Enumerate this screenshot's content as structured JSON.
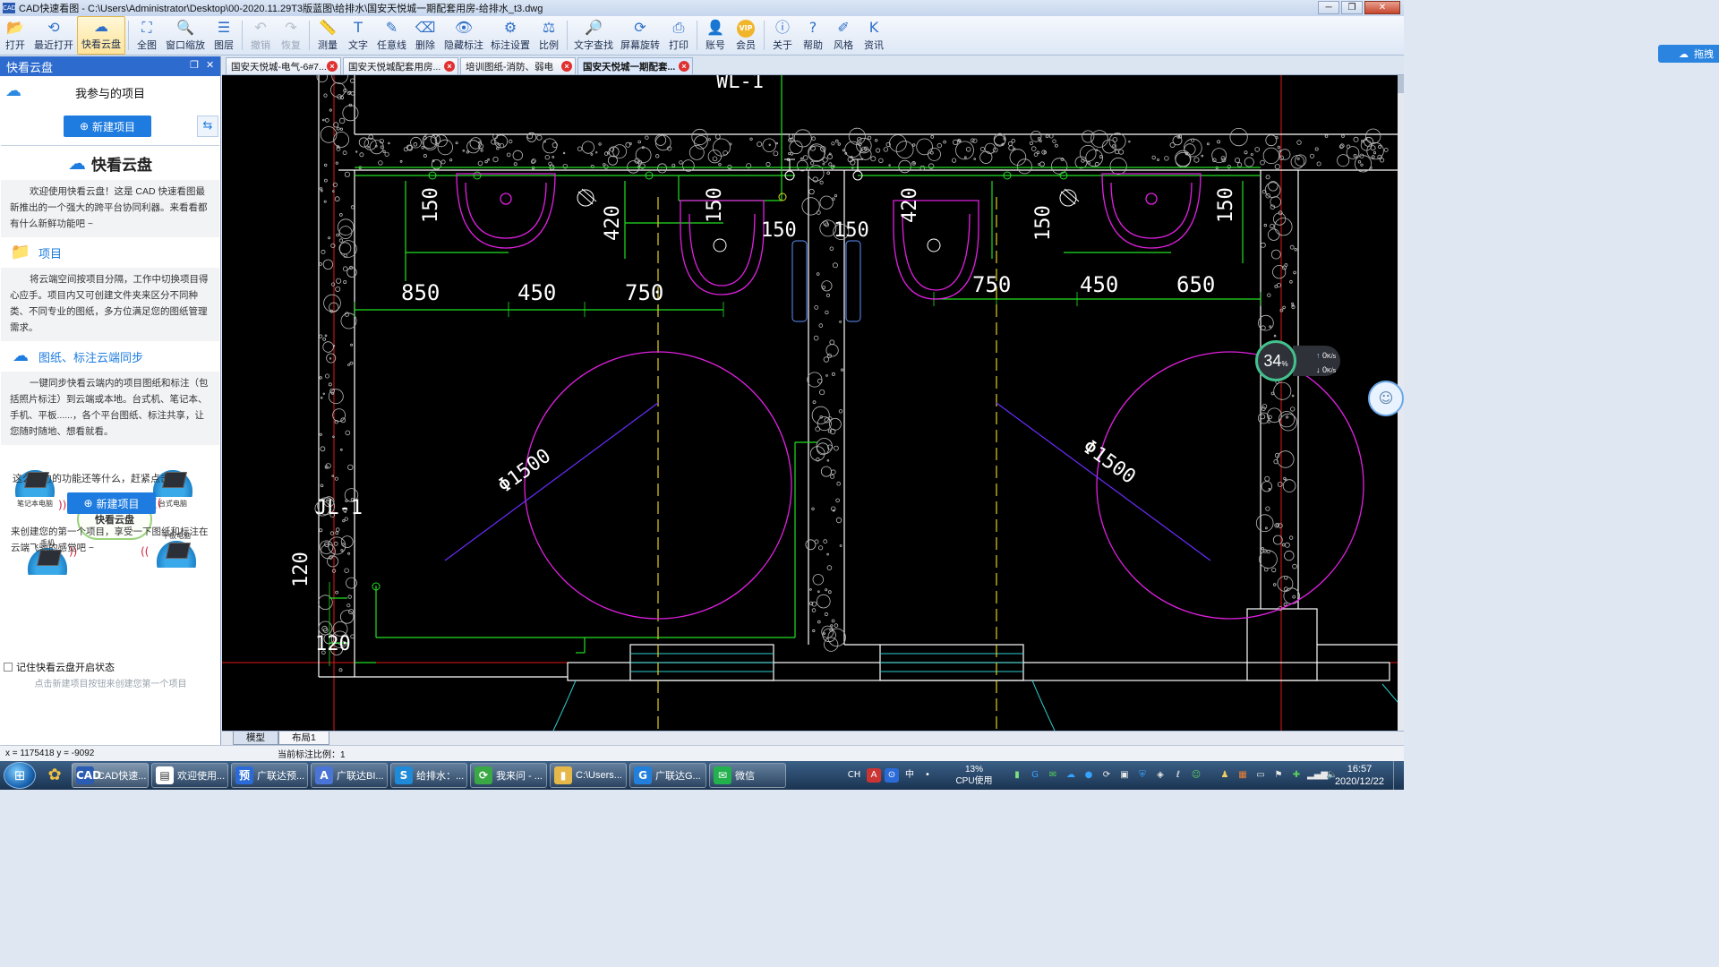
{
  "window": {
    "title": "CAD快速看图 - C:\\Users\\Administrator\\Desktop\\00-2020.11.29T3版蓝图\\给排水\\国安天悦城一期配套用房-给排水_t3.dwg",
    "app_icon": "CAD",
    "minimize": "─",
    "maximize": "❐",
    "close": "✕"
  },
  "toolbar": {
    "items": [
      {
        "id": "open",
        "label": "打开",
        "icon": "folder-open",
        "glyph": "📂"
      },
      {
        "id": "recent",
        "label": "最近打开",
        "icon": "clock",
        "glyph": "⟲"
      },
      {
        "id": "cloud",
        "label": "快看云盘",
        "icon": "cloud",
        "glyph": "☁"
      },
      {
        "id": "full",
        "label": "全图",
        "icon": "fit-screen",
        "glyph": "⛶"
      },
      {
        "id": "window-zoom",
        "label": "窗口缩放",
        "icon": "zoom-window",
        "glyph": "🔍"
      },
      {
        "id": "layers",
        "label": "图层",
        "icon": "layers",
        "glyph": "☰"
      },
      {
        "id": "undo",
        "label": "撤销",
        "icon": "undo",
        "glyph": "↶"
      },
      {
        "id": "redo",
        "label": "恢复",
        "icon": "redo",
        "glyph": "↷"
      },
      {
        "id": "measure",
        "label": "测量",
        "icon": "ruler",
        "glyph": "📏"
      },
      {
        "id": "text",
        "label": "文字",
        "icon": "text",
        "glyph": "T"
      },
      {
        "id": "freeline",
        "label": "任意线",
        "icon": "pen",
        "glyph": "✎"
      },
      {
        "id": "delete",
        "label": "删除",
        "icon": "eraser",
        "glyph": "⌫"
      },
      {
        "id": "hide-anno",
        "label": "隐藏标注",
        "icon": "eye",
        "glyph": "👁"
      },
      {
        "id": "anno-settings",
        "label": "标注设置",
        "icon": "anno-settings",
        "glyph": "⚙"
      },
      {
        "id": "scale",
        "label": "比例",
        "icon": "scale",
        "glyph": "⚖"
      },
      {
        "id": "text-find",
        "label": "文字查找",
        "icon": "text-search",
        "glyph": "🔎"
      },
      {
        "id": "rotate",
        "label": "屏幕旋转",
        "icon": "rotate-screen",
        "glyph": "⟳"
      },
      {
        "id": "print",
        "label": "打印",
        "icon": "printer",
        "glyph": "⎙"
      },
      {
        "id": "account",
        "label": "账号",
        "icon": "user",
        "glyph": "👤"
      },
      {
        "id": "vip",
        "label": "会员",
        "icon": "vip-badge",
        "glyph": "VIP"
      },
      {
        "id": "about",
        "label": "关于",
        "icon": "info",
        "glyph": "ⓘ"
      },
      {
        "id": "help",
        "label": "帮助",
        "icon": "help",
        "glyph": "?"
      },
      {
        "id": "style",
        "label": "风格",
        "icon": "style",
        "glyph": "✐"
      },
      {
        "id": "news",
        "label": "资讯",
        "icon": "news",
        "glyph": "K"
      }
    ],
    "active": "cloud",
    "disabled": [
      "undo",
      "redo"
    ],
    "cloud_login": "拖拽"
  },
  "side_panel": {
    "title": "快看云盘",
    "float_btn": "❐",
    "close_btn": "✕",
    "projects_label": "我参与的项目",
    "new_project_btn": "新建项目",
    "sync_icon": "⇆",
    "card_title": "快看云盘",
    "intro": "欢迎使用快看云盘！这是 CAD 快速看图最新推出的一个强大的跨平台协同利器。来看看都有什么新鲜功能吧 ~",
    "sections": [
      {
        "title": "项目",
        "icon": "project-icon",
        "text": "将云端空间按项目分隔，工作中切换项目得心应手。项目内又可创建文件夹来区分不同种类、不同专业的图纸，多方位满足您的图纸管理需求。"
      },
      {
        "title": "图纸、标注云端同步",
        "icon": "cloud-sync-icon",
        "text": "一键同步快看云端内的项目图纸和标注（包括照片标注）到云端或本地。台式机、笔记本、手机、平板......，各个平台图纸、标注共享，让您随时随地、想看就看。"
      }
    ],
    "diagram": {
      "center": "快看云盘",
      "devices": [
        "笔记本电脑",
        "台式电脑",
        "手机",
        "平板电脑"
      ]
    },
    "more_text": "这么给力的功能还等什么，赶紧点击",
    "new_project_btn2": "新建项目",
    "tail_text": "来创建您的第一个项目，享受一下图纸和标注在云端飞驰的感觉吧 ~",
    "remember_label": "记住快看云盘开启状态",
    "hint": "点击新建项目按钮来创建您第一个项目"
  },
  "doc_tabs": [
    {
      "label": "国安天悦城-电气-6#7...",
      "active": false
    },
    {
      "label": "国安天悦城配套用房...",
      "active": false
    },
    {
      "label": "培训图纸-消防、弱电",
      "active": false
    },
    {
      "label": "国安天悦城一期配套...",
      "active": true
    }
  ],
  "drawing": {
    "pipe_labels": [
      "WL-1",
      "JL-1"
    ],
    "circle_labels": [
      "Φ1500",
      "Φ1500"
    ],
    "dims_left_row": [
      "850",
      "450",
      "750"
    ],
    "dims_right_row": [
      "750",
      "450",
      "650"
    ],
    "vertical_dims": [
      "150",
      "420",
      "150",
      "150",
      "150",
      "420",
      "150"
    ],
    "left_dims": [
      "120",
      "120"
    ]
  },
  "cpu_widget": {
    "percent": "34",
    "unit": "%",
    "up": "0",
    "down": "0",
    "unit_speed": "K/s"
  },
  "space_tabs": [
    {
      "label": "模型",
      "active": true
    },
    {
      "label": "布局1",
      "active": false
    }
  ],
  "status": {
    "coords": "x = 1175418  y = -9092",
    "scale": "当前标注比例：1"
  },
  "taskbar": {
    "start": "⊞",
    "quick": [
      "✿"
    ],
    "tasks": [
      {
        "label": "CAD快速...",
        "icon": "CAD",
        "color": "#2a5cb3",
        "on": true
      },
      {
        "label": "欢迎使用...",
        "icon": "▤",
        "color": "#ffffff",
        "on": false
      },
      {
        "label": "广联达预...",
        "icon": "预",
        "color": "#2b6bd8",
        "on": false
      },
      {
        "label": "广联达BI...",
        "icon": "A",
        "color": "#4a74d6",
        "on": false
      },
      {
        "label": "给排水：...",
        "icon": "S",
        "color": "#1f8ad8",
        "on": false
      },
      {
        "label": "我来问 - ...",
        "icon": "⟳",
        "color": "#3aa845",
        "on": false
      },
      {
        "label": "C:\\Users...",
        "icon": "▮",
        "color": "#e6b84a",
        "on": false
      },
      {
        "label": "广联达G...",
        "icon": "G",
        "color": "#2280dc",
        "on": false
      },
      {
        "label": "微信",
        "icon": "✉",
        "color": "#22b14c",
        "on": false
      }
    ],
    "tray_lang": "CH",
    "cpu_percent": "13%",
    "cpu_label": "CPU使用",
    "time": "16:57",
    "date": "2020/12/22"
  }
}
